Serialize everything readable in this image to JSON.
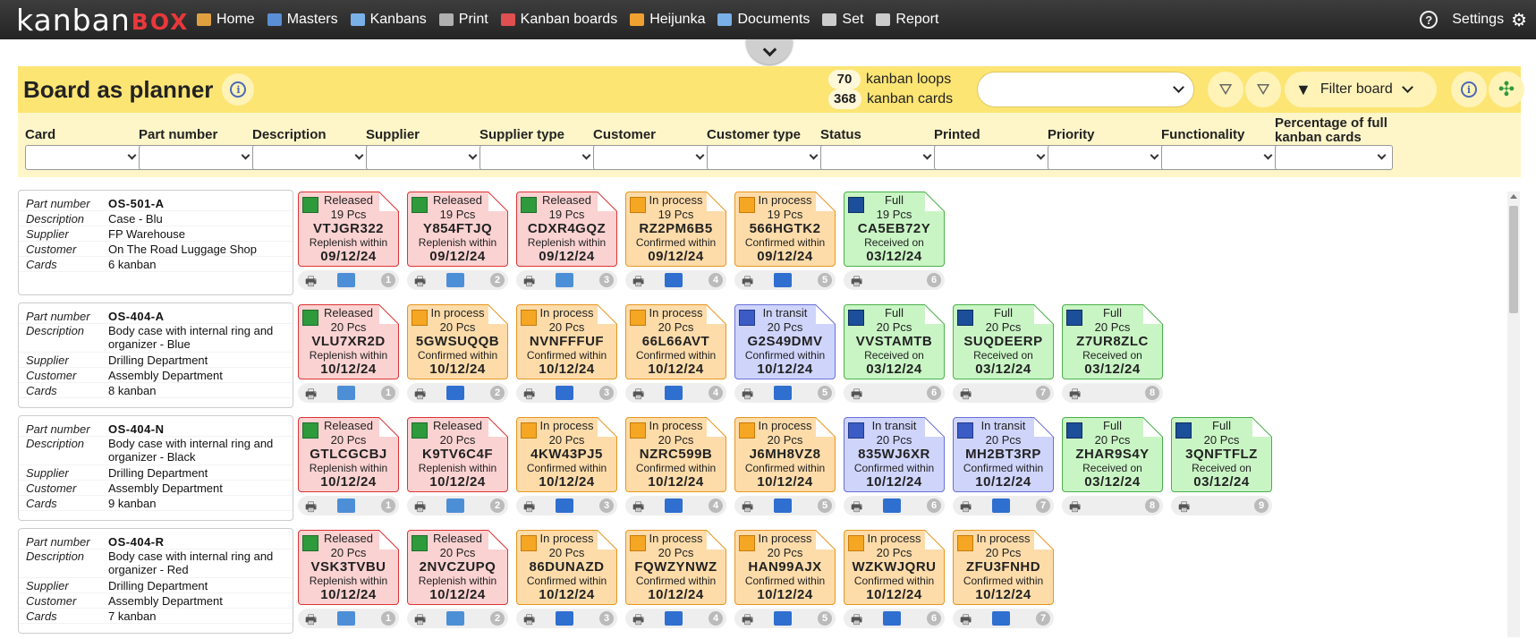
{
  "app": {
    "logo_main": "kanban",
    "logo_accent": "BOX"
  },
  "nav": {
    "items": [
      {
        "label": "Home",
        "icon": "home-icon",
        "color": "#e0a040"
      },
      {
        "label": "Masters",
        "icon": "masters-icon",
        "color": "#5a8fd6"
      },
      {
        "label": "Kanbans",
        "icon": "kanbans-icon",
        "color": "#7ab0e8"
      },
      {
        "label": "Print",
        "icon": "print-icon",
        "color": "#b0b0b0"
      },
      {
        "label": "Kanban boards",
        "icon": "kanban-boards-icon",
        "color": "#e05050"
      },
      {
        "label": "Heijunka",
        "icon": "heijunka-icon",
        "color": "#f0a030"
      },
      {
        "label": "Documents",
        "icon": "documents-icon",
        "color": "#7ab0e8"
      },
      {
        "label": "Set",
        "icon": "set-icon",
        "color": "#cccccc"
      },
      {
        "label": "Report",
        "icon": "report-icon",
        "color": "#cccccc"
      }
    ],
    "settings_label": "Settings"
  },
  "header": {
    "title": "Board as planner",
    "loops_count": "70",
    "loops_label": "kanban loops",
    "cards_count": "368",
    "cards_label": "kanban cards",
    "filter_board_label": "Filter board"
  },
  "filters": [
    {
      "label": "Card"
    },
    {
      "label": "Part number"
    },
    {
      "label": "Description"
    },
    {
      "label": "Supplier"
    },
    {
      "label": "Supplier type"
    },
    {
      "label": "Customer"
    },
    {
      "label": "Customer type"
    },
    {
      "label": "Status"
    },
    {
      "label": "Printed"
    },
    {
      "label": "Priority"
    },
    {
      "label": "Functionality"
    },
    {
      "label": "Percentage of full kanban cards"
    }
  ],
  "info_labels": {
    "part_number": "Part number",
    "description": "Description",
    "supplier": "Supplier",
    "customer": "Customer",
    "cards": "Cards"
  },
  "rows": [
    {
      "part_number": "OS-501-A",
      "description": "Case - Blu",
      "supplier": "FP Warehouse",
      "customer": "On The Road Luggage Shop",
      "cards": "6 kanban",
      "kanbans": [
        {
          "status": "Released",
          "qty": "19 Pcs",
          "code": "VTJGR322",
          "label": "Replenish within",
          "date": "09/12/24",
          "num": "1"
        },
        {
          "status": "Released",
          "qty": "19 Pcs",
          "code": "Y854FTJQ",
          "label": "Replenish within",
          "date": "09/12/24",
          "num": "2"
        },
        {
          "status": "Released",
          "qty": "19 Pcs",
          "code": "CDXR4GQZ",
          "label": "Replenish within",
          "date": "09/12/24",
          "num": "3"
        },
        {
          "status": "In process",
          "qty": "19 Pcs",
          "code": "RZ2PM6B5",
          "label": "Confirmed within",
          "date": "09/12/24",
          "num": "4"
        },
        {
          "status": "In process",
          "qty": "19 Pcs",
          "code": "566HGTK2",
          "label": "Confirmed within",
          "date": "09/12/24",
          "num": "5"
        },
        {
          "status": "Full",
          "qty": "19 Pcs",
          "code": "CA5EB72Y",
          "label": "Received on",
          "date": "03/12/24",
          "num": "6"
        }
      ]
    },
    {
      "part_number": "OS-404-A",
      "description": "Body case with internal ring and organizer - Blue",
      "supplier": "Drilling Department",
      "customer": "Assembly Department",
      "cards": "8 kanban",
      "kanbans": [
        {
          "status": "Released",
          "qty": "20 Pcs",
          "code": "VLU7XR2D",
          "label": "Replenish within",
          "date": "10/12/24",
          "num": "1"
        },
        {
          "status": "In process",
          "qty": "20 Pcs",
          "code": "5GWSUQQB",
          "label": "Confirmed within",
          "date": "10/12/24",
          "num": "2"
        },
        {
          "status": "In process",
          "qty": "20 Pcs",
          "code": "NVNFFFUF",
          "label": "Confirmed within",
          "date": "10/12/24",
          "num": "3"
        },
        {
          "status": "In process",
          "qty": "20 Pcs",
          "code": "66L66AVT",
          "label": "Confirmed within",
          "date": "10/12/24",
          "num": "4"
        },
        {
          "status": "In transit",
          "qty": "20 Pcs",
          "code": "G2S49DMV",
          "label": "Confirmed within",
          "date": "10/12/24",
          "num": "5"
        },
        {
          "status": "Full",
          "qty": "20 Pcs",
          "code": "VVSTAMTB",
          "label": "Received on",
          "date": "03/12/24",
          "num": "6"
        },
        {
          "status": "Full",
          "qty": "20 Pcs",
          "code": "SUQDEERP",
          "label": "Received on",
          "date": "03/12/24",
          "num": "7"
        },
        {
          "status": "Full",
          "qty": "20 Pcs",
          "code": "Z7UR8ZLC",
          "label": "Received on",
          "date": "03/12/24",
          "num": "8"
        }
      ]
    },
    {
      "part_number": "OS-404-N",
      "description": "Body case with internal ring and organizer - Black",
      "supplier": "Drilling Department",
      "customer": "Assembly Department",
      "cards": "9 kanban",
      "kanbans": [
        {
          "status": "Released",
          "qty": "20 Pcs",
          "code": "GTLCGCBJ",
          "label": "Replenish within",
          "date": "10/12/24",
          "num": "1"
        },
        {
          "status": "Released",
          "qty": "20 Pcs",
          "code": "K9TV6C4F",
          "label": "Replenish within",
          "date": "10/12/24",
          "num": "2"
        },
        {
          "status": "In process",
          "qty": "20 Pcs",
          "code": "4KW43PJ5",
          "label": "Confirmed within",
          "date": "10/12/24",
          "num": "3"
        },
        {
          "status": "In process",
          "qty": "20 Pcs",
          "code": "NZRC599B",
          "label": "Confirmed within",
          "date": "10/12/24",
          "num": "4"
        },
        {
          "status": "In process",
          "qty": "20 Pcs",
          "code": "J6MH8VZ8",
          "label": "Confirmed within",
          "date": "10/12/24",
          "num": "5"
        },
        {
          "status": "In transit",
          "qty": "20 Pcs",
          "code": "835WJ6XR",
          "label": "Confirmed within",
          "date": "10/12/24",
          "num": "6"
        },
        {
          "status": "In transit",
          "qty": "20 Pcs",
          "code": "MH2BT3RP",
          "label": "Confirmed within",
          "date": "10/12/24",
          "num": "7"
        },
        {
          "status": "Full",
          "qty": "20 Pcs",
          "code": "ZHAR9S4Y",
          "label": "Received on",
          "date": "03/12/24",
          "num": "8"
        },
        {
          "status": "Full",
          "qty": "20 Pcs",
          "code": "3QNFTFLZ",
          "label": "Received on",
          "date": "03/12/24",
          "num": "9"
        }
      ]
    },
    {
      "part_number": "OS-404-R",
      "description": "Body case with internal ring and organizer - Red",
      "supplier": "Drilling Department",
      "customer": "Assembly Department",
      "cards": "7 kanban",
      "kanbans": [
        {
          "status": "Released",
          "qty": "20 Pcs",
          "code": "VSK3TVBU",
          "label": "Replenish within",
          "date": "10/12/24",
          "num": "1"
        },
        {
          "status": "Released",
          "qty": "20 Pcs",
          "code": "2NVCZUPQ",
          "label": "Replenish within",
          "date": "10/12/24",
          "num": "2"
        },
        {
          "status": "In process",
          "qty": "20 Pcs",
          "code": "86DUNAZD",
          "label": "Confirmed within",
          "date": "10/12/24",
          "num": "3"
        },
        {
          "status": "In process",
          "qty": "20 Pcs",
          "code": "FQWZYNWZ",
          "label": "Confirmed within",
          "date": "10/12/24",
          "num": "4"
        },
        {
          "status": "In process",
          "qty": "20 Pcs",
          "code": "HAN99AJX",
          "label": "Confirmed within",
          "date": "10/12/24",
          "num": "5"
        },
        {
          "status": "In process",
          "qty": "20 Pcs",
          "code": "WZKWJQRU",
          "label": "Confirmed within",
          "date": "10/12/24",
          "num": "6"
        },
        {
          "status": "In process",
          "qty": "20 Pcs",
          "code": "ZFU3FNHD",
          "label": "Confirmed within",
          "date": "10/12/24",
          "num": "7"
        }
      ]
    }
  ]
}
